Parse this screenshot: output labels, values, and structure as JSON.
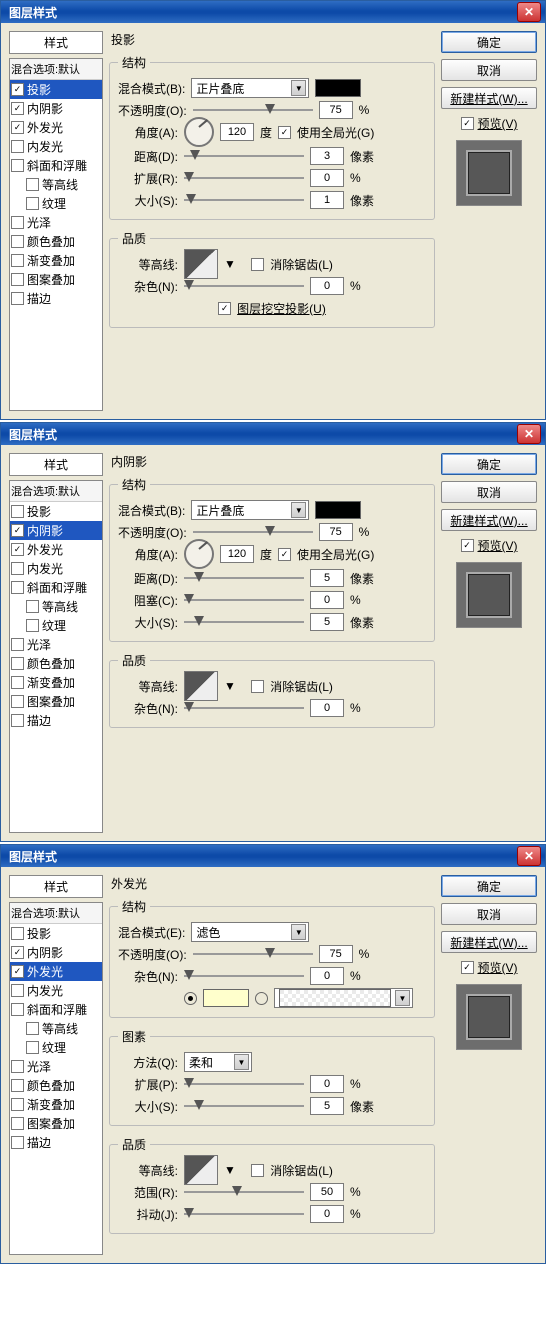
{
  "common": {
    "dialog_title": "图层样式",
    "styles_header": "样式",
    "blend_default": "混合选项:默认",
    "style_names": {
      "drop_shadow": "投影",
      "inner_shadow": "内阴影",
      "outer_glow": "外发光",
      "inner_glow": "内发光",
      "bevel_emboss": "斜面和浮雕",
      "contour": "等高线",
      "texture": "纹理",
      "satin": "光泽",
      "color_overlay": "颜色叠加",
      "gradient_overlay": "渐变叠加",
      "pattern_overlay": "图案叠加",
      "stroke": "描边"
    },
    "buttons": {
      "ok": "确定",
      "cancel": "取消",
      "new_style": "新建样式(W)...",
      "preview": "预览(V)"
    },
    "labels": {
      "structure": "结构",
      "quality": "品质",
      "elements": "图素",
      "blend_mode": "混合模式(B):",
      "blend_mode_e": "混合模式(E):",
      "opacity": "不透明度(O):",
      "angle": "角度(A):",
      "distance": "距离(D):",
      "spread": "扩展(R):",
      "spread_p": "扩展(P):",
      "choke": "阻塞(C):",
      "size": "大小(S):",
      "contour_label": "等高线:",
      "noise": "杂色(N):",
      "technique": "方法(Q):",
      "range": "范围(R):",
      "jitter": "抖动(J):",
      "degree": "度",
      "px": "像素",
      "pct": "%",
      "global_light": "使用全局光(G)",
      "anti_alias": "消除锯齿(L)",
      "knock_out": "图层挖空投影(U)"
    },
    "blend_values": {
      "multiply": "正片叠底",
      "screen": "滤色",
      "soft": "柔和"
    }
  },
  "panels": [
    {
      "section": "投影",
      "selected": "drop_shadow",
      "checked": [
        "drop_shadow",
        "inner_shadow",
        "outer_glow"
      ],
      "structure": {
        "blend_mode_key": "blend_mode",
        "blend_value": "multiply",
        "opacity": "75",
        "angle": "120",
        "global_light": true,
        "rows": [
          {
            "lab": "distance",
            "val": "3",
            "unit": "px",
            "thumb": 5
          },
          {
            "lab": "spread",
            "val": "0",
            "unit": "pct",
            "thumb": 0
          },
          {
            "lab": "size",
            "val": "1",
            "unit": "px",
            "thumb": 2
          }
        ],
        "color_swatch": "#000000"
      },
      "quality": {
        "noise": "0",
        "anti_alias": false,
        "knock_out": true
      }
    },
    {
      "section": "内阴影",
      "selected": "inner_shadow",
      "checked": [
        "inner_shadow",
        "outer_glow"
      ],
      "structure": {
        "blend_mode_key": "blend_mode",
        "blend_value": "multiply",
        "opacity": "75",
        "angle": "120",
        "global_light": true,
        "rows": [
          {
            "lab": "distance",
            "val": "5",
            "unit": "px",
            "thumb": 8
          },
          {
            "lab": "choke",
            "val": "0",
            "unit": "pct",
            "thumb": 0
          },
          {
            "lab": "size",
            "val": "5",
            "unit": "px",
            "thumb": 8
          }
        ],
        "color_swatch": "#000000"
      },
      "quality": {
        "noise": "0",
        "anti_alias": false
      }
    },
    {
      "section": "外发光",
      "selected": "outer_glow",
      "checked": [
        "inner_shadow",
        "outer_glow"
      ],
      "structure": {
        "blend_mode_key": "blend_mode_e",
        "blend_value": "screen",
        "opacity": "75",
        "noise": "0",
        "glow_color": true
      },
      "elements": {
        "technique_value": "soft",
        "rows": [
          {
            "lab": "spread_p",
            "val": "0",
            "unit": "pct",
            "thumb": 0
          },
          {
            "lab": "size",
            "val": "5",
            "unit": "px",
            "thumb": 8
          }
        ]
      },
      "quality": {
        "anti_alias": false,
        "range": "50",
        "jitter": "0"
      }
    }
  ]
}
